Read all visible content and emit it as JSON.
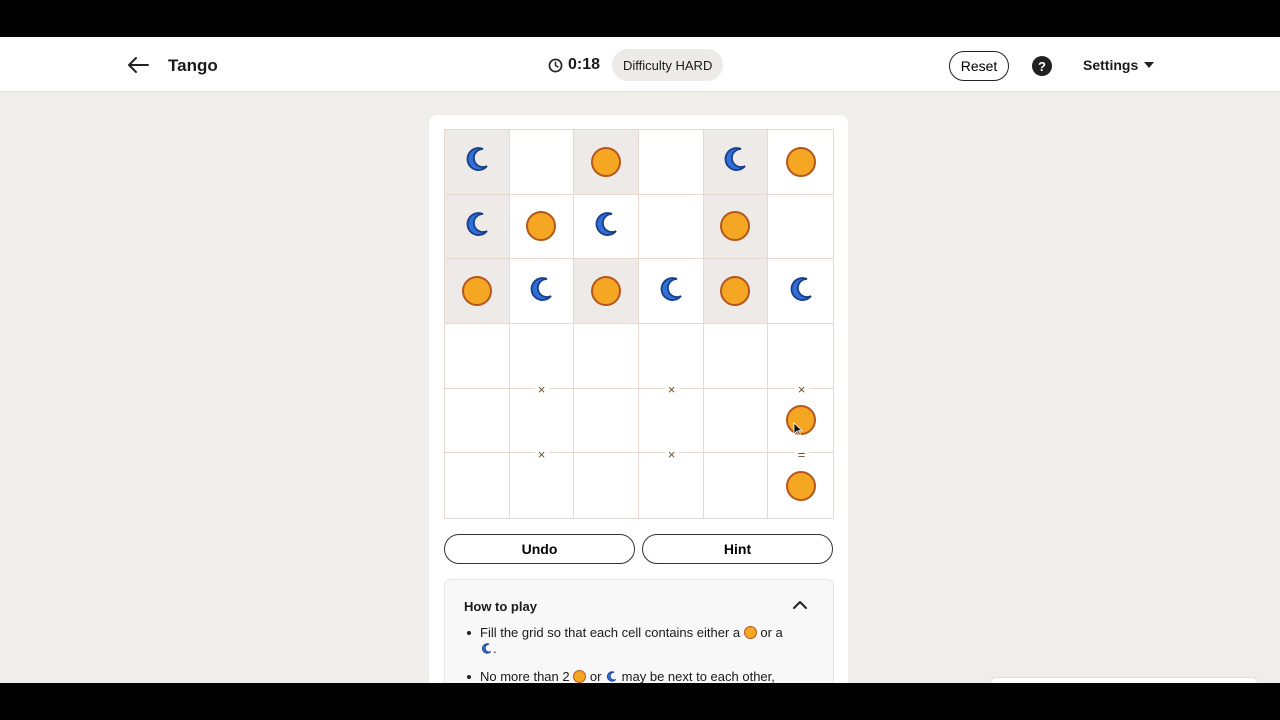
{
  "header": {
    "title": "Tango",
    "timer": "0:18",
    "difficulty_label": "Difficulty HARD",
    "reset_label": "Reset",
    "help_label": "?",
    "settings_label": "Settings"
  },
  "board": {
    "size": 6,
    "cells": [
      [
        "moon",
        "",
        "sun",
        "",
        "moon",
        "sun"
      ],
      [
        "moon",
        "sun",
        "moon",
        "",
        "sun",
        ""
      ],
      [
        "sun",
        "moon",
        "sun",
        "moon",
        "sun",
        "moon"
      ],
      [
        "",
        "",
        "",
        "",
        "",
        ""
      ],
      [
        "",
        "",
        "",
        "",
        "",
        "sun"
      ],
      [
        "",
        "",
        "",
        "",
        "",
        "sun"
      ]
    ],
    "locked": [
      [
        true,
        false,
        true,
        false,
        true,
        false
      ],
      [
        true,
        false,
        false,
        false,
        true,
        false
      ],
      [
        true,
        false,
        true,
        false,
        true,
        false
      ],
      [
        false,
        false,
        false,
        false,
        false,
        false
      ],
      [
        false,
        false,
        false,
        false,
        false,
        false
      ],
      [
        false,
        false,
        false,
        false,
        false,
        false
      ]
    ],
    "markers": [
      {
        "between_rows": [
          3,
          4
        ],
        "col": 1,
        "symbol": "×"
      },
      {
        "between_rows": [
          3,
          4
        ],
        "col": 3,
        "symbol": "×"
      },
      {
        "between_rows": [
          3,
          4
        ],
        "col": 5,
        "symbol": "×"
      },
      {
        "between_rows": [
          4,
          5
        ],
        "col": 1,
        "symbol": "×"
      },
      {
        "between_rows": [
          4,
          5
        ],
        "col": 3,
        "symbol": "×"
      },
      {
        "between_rows": [
          4,
          5
        ],
        "col": 5,
        "symbol": "="
      }
    ]
  },
  "controls": {
    "undo_label": "Undo",
    "hint_label": "Hint"
  },
  "how_to_play": {
    "title": "How to play",
    "rule1_a": "Fill the grid so that each cell contains either a",
    "rule1_b": "or a",
    "rule1_c": ".",
    "rule2_a": "No more than 2",
    "rule2_b": "or",
    "rule2_c": "may be next to each other,"
  },
  "colors": {
    "sun_fill": "#f5a623",
    "sun_stroke": "#b5561c",
    "moon_fill": "#2f6fd6",
    "moon_stroke": "#1a3f8a",
    "locked_cell": "#eeeae7"
  }
}
